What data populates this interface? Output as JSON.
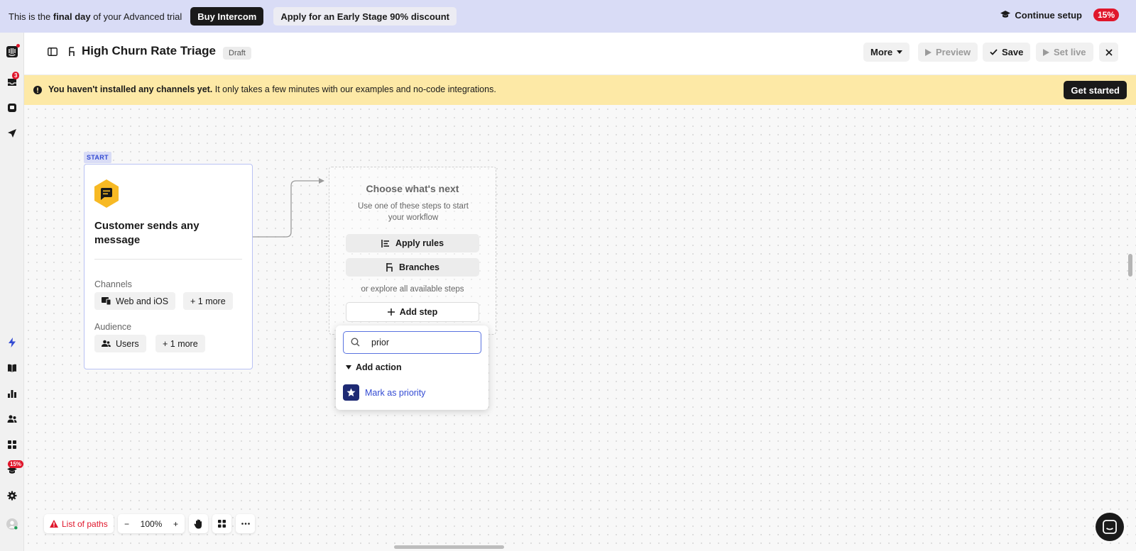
{
  "trial_banner": {
    "text_prefix": "This is the ",
    "text_bold": "final day",
    "text_suffix": " of your Advanced trial",
    "buy_label": "Buy Intercom",
    "discount_label": "Apply for an Early Stage 90% discount",
    "continue_label": "Continue setup",
    "setup_percent": "15%"
  },
  "left_rail": {
    "inbox_badge": "3",
    "setup_badge": "15%"
  },
  "header": {
    "title": "High Churn Rate Triage",
    "status": "Draft",
    "more_label": "More",
    "preview_label": "Preview",
    "save_label": "Save",
    "set_live_label": "Set live"
  },
  "channels_banner": {
    "bold_text": "You haven't installed any channels yet.",
    "text": " It only takes a few minutes with our examples and no-code integrations.",
    "cta_label": "Get started"
  },
  "trigger": {
    "start_tag": "START",
    "title": "Customer sends any message",
    "channels_label": "Channels",
    "channels_chip": "Web and iOS",
    "channels_more": "+ 1 more",
    "audience_label": "Audience",
    "audience_chip": "Users",
    "audience_more": "+ 1 more"
  },
  "next_step": {
    "title": "Choose what's next",
    "subtitle": "Use one of these steps to start your workflow",
    "apply_rules_label": "Apply rules",
    "branches_label": "Branches",
    "explore_text": "or explore all available steps",
    "add_step_label": "Add step"
  },
  "step_picker": {
    "search_value": "prior",
    "group_label": "Add action",
    "items": [
      {
        "label": "Mark as priority"
      }
    ]
  },
  "bottom_toolbar": {
    "paths_label": "List of paths",
    "zoom_out": "−",
    "zoom_level": "100%",
    "zoom_in": "+"
  },
  "colors": {
    "accent": "#334bd3",
    "danger": "#e0162b",
    "trigger_icon": "#f7b924",
    "banner_warning": "#fde9a6",
    "banner_trial": "#d9dcf6"
  }
}
